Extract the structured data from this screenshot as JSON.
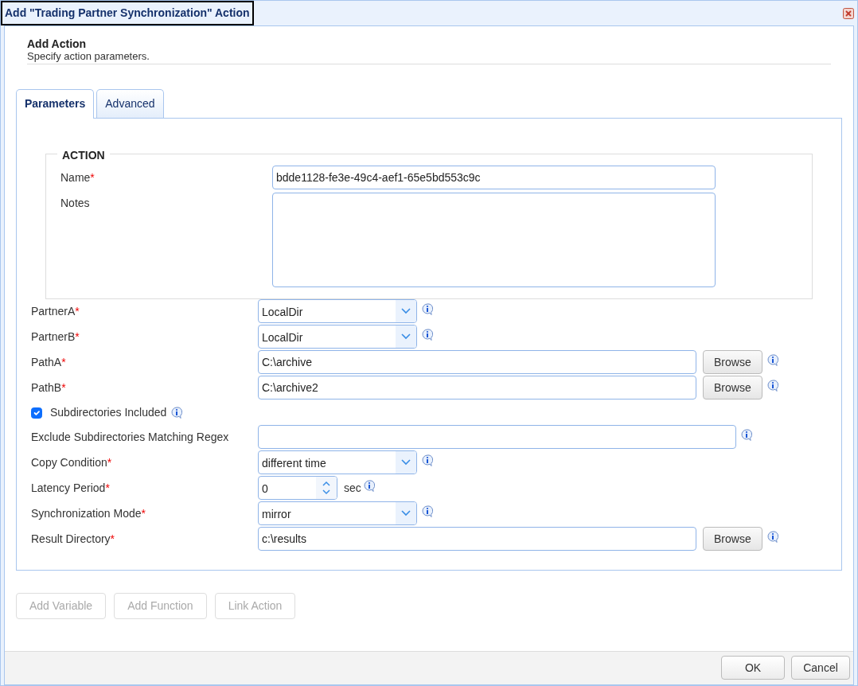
{
  "window": {
    "title": "Add \"Trading Partner Synchronization\" Action"
  },
  "header": {
    "title": "Add Action",
    "subtitle": "Specify action parameters."
  },
  "tabs": [
    {
      "label": "Parameters",
      "selected": true
    },
    {
      "label": "Advanced",
      "selected": false
    }
  ],
  "action_section": {
    "legend": "ACTION",
    "fields": [
      {
        "kind": "text",
        "label": "Name",
        "required_mark": "*",
        "value": "bdde1128-fe3e-49c4-aef1-65e5bd553c9c"
      },
      {
        "kind": "textarea",
        "label": "Notes"
      }
    ]
  },
  "fields": [
    {
      "kind": "select",
      "label": "PartnerA",
      "required_mark": "*",
      "value": "LocalDir",
      "help": true
    },
    {
      "kind": "select",
      "label": "PartnerB",
      "required_mark": "*",
      "value": "LocalDir",
      "help": true
    },
    {
      "kind": "browse",
      "label": "PathA",
      "required_mark": "*",
      "value": "C:\\archive",
      "button": "Browse",
      "help": true
    },
    {
      "kind": "browse",
      "label": "PathB",
      "required_mark": "*",
      "value": "C:\\archive2",
      "button": "Browse",
      "help": true
    },
    {
      "kind": "checkbox",
      "label": "Subdirectories Included",
      "checked": true,
      "help": true
    },
    {
      "kind": "wide",
      "label": "Exclude Subdirectories Matching Regex",
      "help": true
    },
    {
      "kind": "select",
      "label": "Copy Condition",
      "required_mark": "*",
      "value": "different time",
      "help": true
    },
    {
      "kind": "number",
      "label": "Latency Period",
      "required_mark": "*",
      "value": "0",
      "unit": "sec",
      "help": true
    },
    {
      "kind": "select",
      "label": "Synchronization Mode",
      "required_mark": "*",
      "value": "mirror",
      "help": true
    },
    {
      "kind": "browse",
      "label": "Result Directory",
      "required_mark": "*",
      "value": "c:\\results",
      "button": "Browse",
      "help": true
    }
  ],
  "tool_buttons": [
    {
      "label": "Add Variable",
      "disabled": true
    },
    {
      "label": "Add Function",
      "disabled": true
    },
    {
      "label": "Link Action",
      "disabled": true
    }
  ],
  "footer_buttons": [
    {
      "label": "OK"
    },
    {
      "label": "Cancel"
    }
  ]
}
